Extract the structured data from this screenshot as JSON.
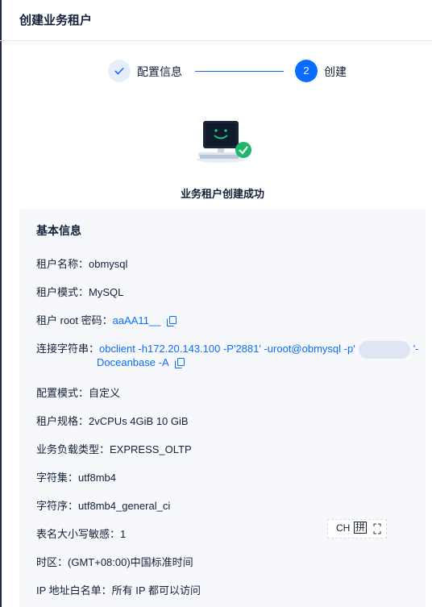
{
  "header": {
    "title": "创建业务租户"
  },
  "steps": [
    {
      "label": "配置信息",
      "state": "done",
      "icon": "check-icon"
    },
    {
      "label": "创建",
      "number": "2",
      "state": "active"
    }
  ],
  "result": {
    "message": "业务租户创建成功",
    "illustration": "computer-success-icon"
  },
  "info": {
    "title": "基本信息",
    "rows": [
      {
        "label": "租户名称：",
        "value": "obmysql"
      },
      {
        "label": "租户模式：",
        "value": "MySQL"
      },
      {
        "label": "租户 root 密码：",
        "value": "aaAA11__"
      },
      {
        "label": "连接字符串：",
        "value_part1": "obclient -h172.20.143.100 -P'2881' -uroot@obmysql -p'",
        "value_part2": "'-",
        "value_line2": "Doceanbase -A"
      },
      {
        "label": "配置模式：",
        "value": "自定义"
      },
      {
        "label": "租户规格：",
        "value": "2vCPUs 4GiB 10 GiB"
      },
      {
        "label": "业务负载类型：",
        "value": "EXPRESS_OLTP"
      },
      {
        "label": "字符集：",
        "value": "utf8mb4"
      },
      {
        "label": "字符序：",
        "value": "utf8mb4_general_ci"
      },
      {
        "label": "表名大小写敏感：",
        "value": "1"
      },
      {
        "label": "时区：",
        "value": "(GMT+08:00)中国标准时间"
      },
      {
        "label": "IP 地址白名单：",
        "value": "所有 IP 都可以访问"
      }
    ]
  },
  "ime_toolbar": {
    "mode": "CH",
    "input": "拼"
  },
  "colors": {
    "primary": "#0a6cff",
    "success": "#1fb86b",
    "panel_bg": "#f6f8fb",
    "text": "#132039"
  }
}
